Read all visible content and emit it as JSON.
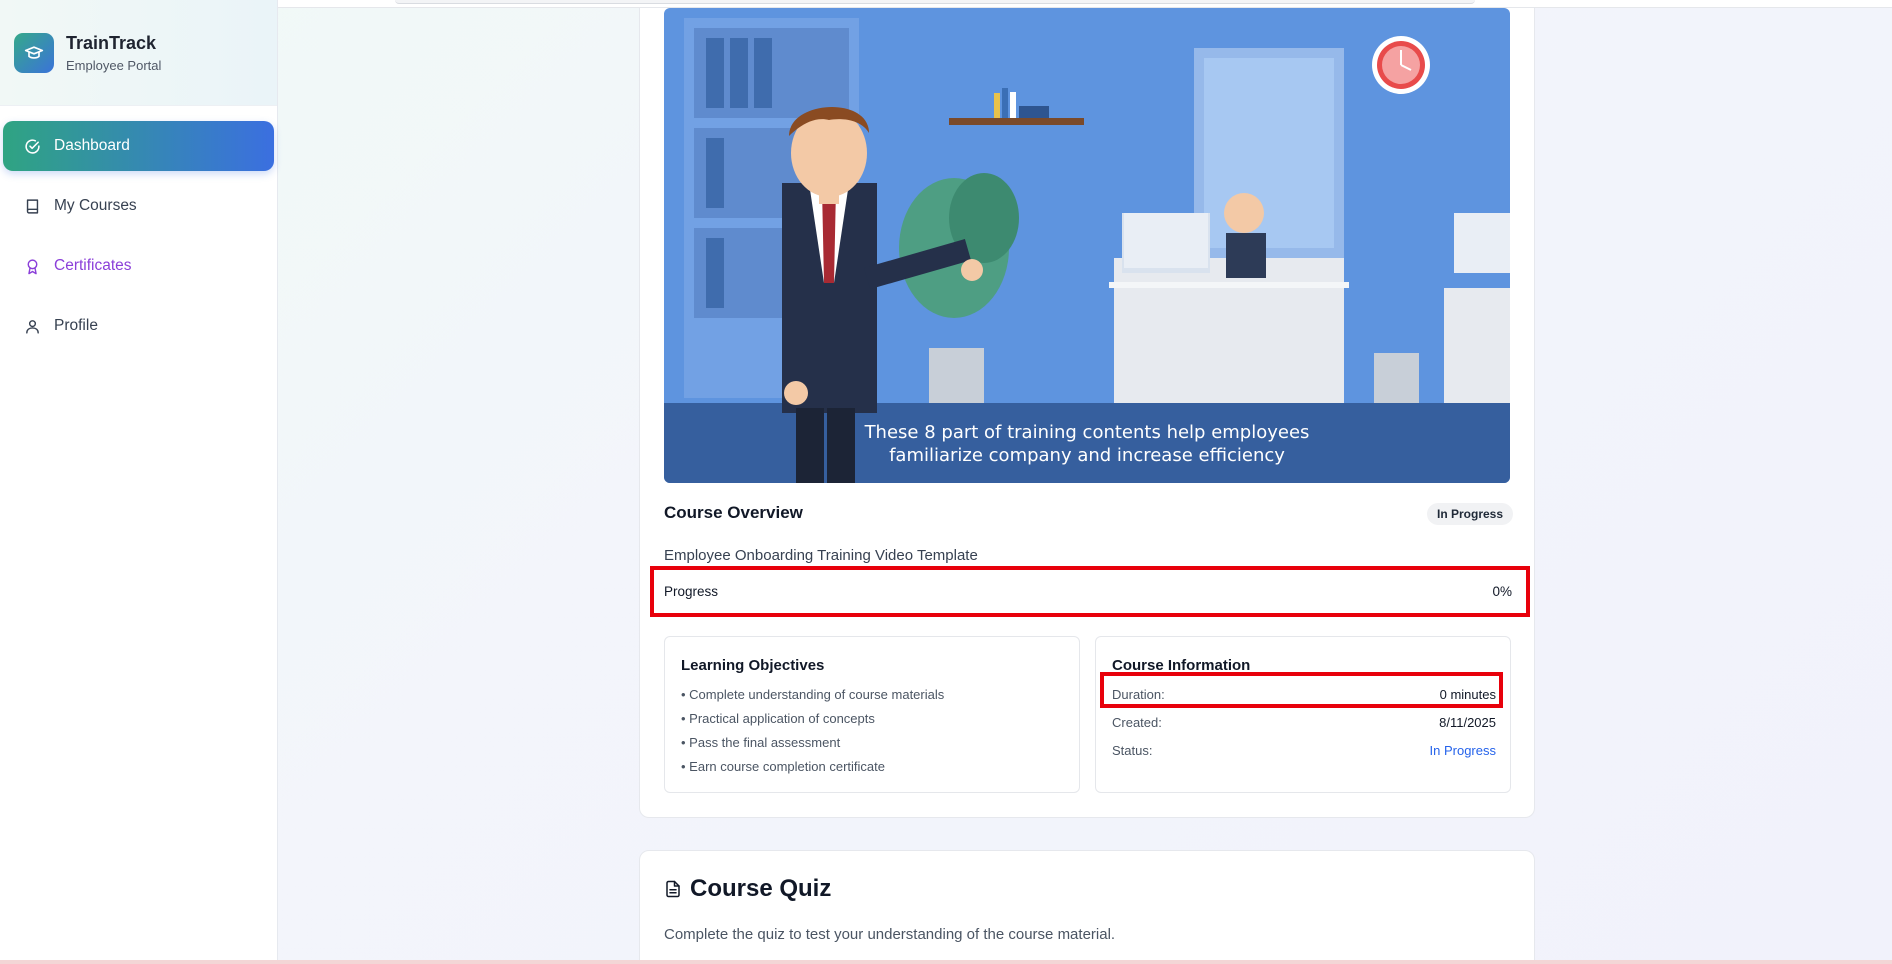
{
  "brand": {
    "title": "TrainTrack",
    "subtitle": "Employee Portal",
    "logo_icon": "graduation-cap-icon"
  },
  "sidebar": {
    "items": [
      {
        "label": "Dashboard",
        "icon": "check-circle-icon",
        "active": true
      },
      {
        "label": "My Courses",
        "icon": "book-icon",
        "active": false
      },
      {
        "label": "Certificates",
        "icon": "award-icon",
        "active": false
      },
      {
        "label": "Profile",
        "icon": "user-icon",
        "active": false
      }
    ]
  },
  "video": {
    "caption_line1": "These 8 part of training contents help employees",
    "caption_line2": "familiarize company and increase efficiency"
  },
  "overview": {
    "title": "Course Overview",
    "status_badge": "In Progress",
    "course_name": "Employee Onboarding Training Video Template",
    "progress_label": "Progress",
    "progress_value": "0%",
    "progress_fraction": 0
  },
  "objectives": {
    "title": "Learning Objectives",
    "items": [
      "• Complete understanding of course materials",
      "• Practical application of concepts",
      "• Pass the final assessment",
      "• Earn course completion certificate"
    ]
  },
  "course_info": {
    "title": "Course Information",
    "rows": [
      {
        "label": "Duration:",
        "value": "0 minutes"
      },
      {
        "label": "Created:",
        "value": "8/11/2025"
      },
      {
        "label": "Status:",
        "value": "In Progress"
      }
    ]
  },
  "quiz": {
    "title": "Course Quiz",
    "description": "Complete the quiz to test your understanding of the course material.",
    "icon": "document-icon"
  },
  "colors": {
    "accent_start": "#2fa482",
    "accent_end": "#3b6fe0",
    "highlight_red": "#e8000b",
    "status_blue": "#2563eb",
    "certificates_purple": "#8b3fd9"
  }
}
